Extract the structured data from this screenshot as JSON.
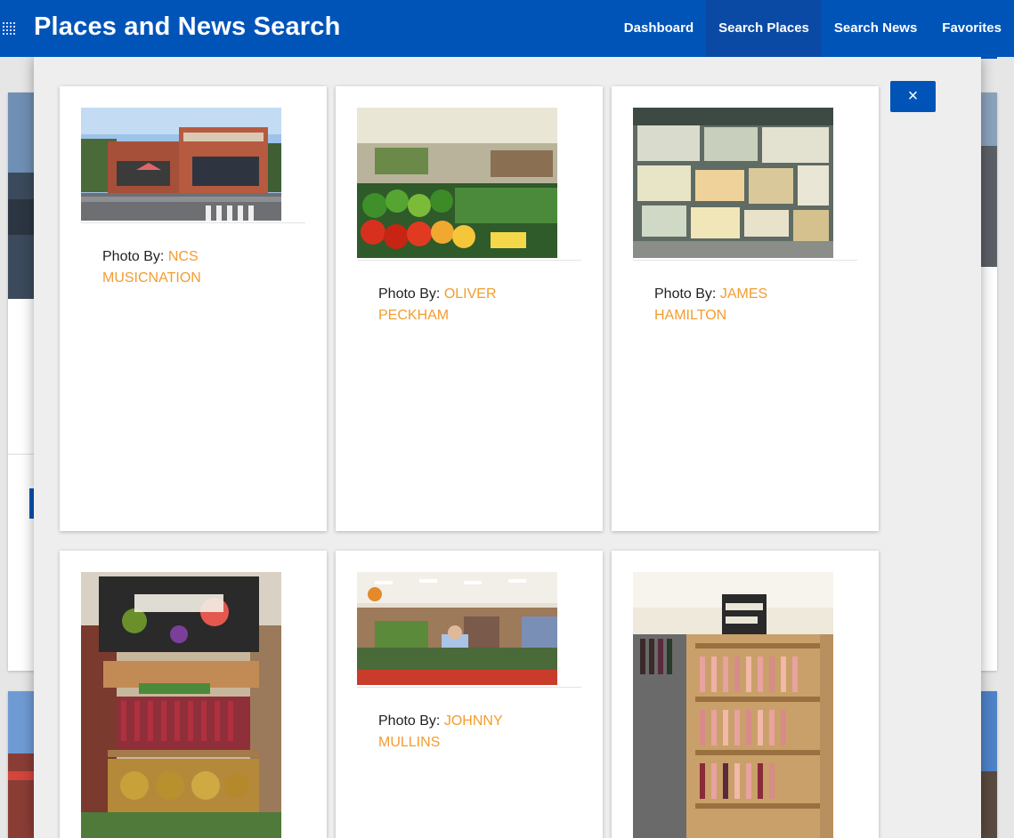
{
  "app": {
    "title": "Places and News Search",
    "nav": [
      {
        "label": "Dashboard",
        "active": false
      },
      {
        "label": "Search Places",
        "active": true
      },
      {
        "label": "Search News",
        "active": false
      },
      {
        "label": "Favorites",
        "active": false
      }
    ]
  },
  "modal": {
    "close_symbol": "×",
    "photos": [
      {
        "prefix": "Photo By:",
        "author": "NCS MUSICNATION",
        "subject": "store-exterior"
      },
      {
        "prefix": "Photo By:",
        "author": "OLIVER PECKHAM",
        "subject": "produce-peppers"
      },
      {
        "prefix": "Photo By:",
        "author": "JAMES HAMILTON",
        "subject": "cheese-case"
      },
      {
        "prefix": "",
        "author": "",
        "subject": "produce-sign"
      },
      {
        "prefix": "Photo By:",
        "author": "JOHNNY MULLINS",
        "subject": "store-interior"
      },
      {
        "prefix": "",
        "author": "",
        "subject": "wine-shelf"
      }
    ]
  },
  "colors": {
    "brand": "#0054b8",
    "accent_link": "#f39c30"
  }
}
